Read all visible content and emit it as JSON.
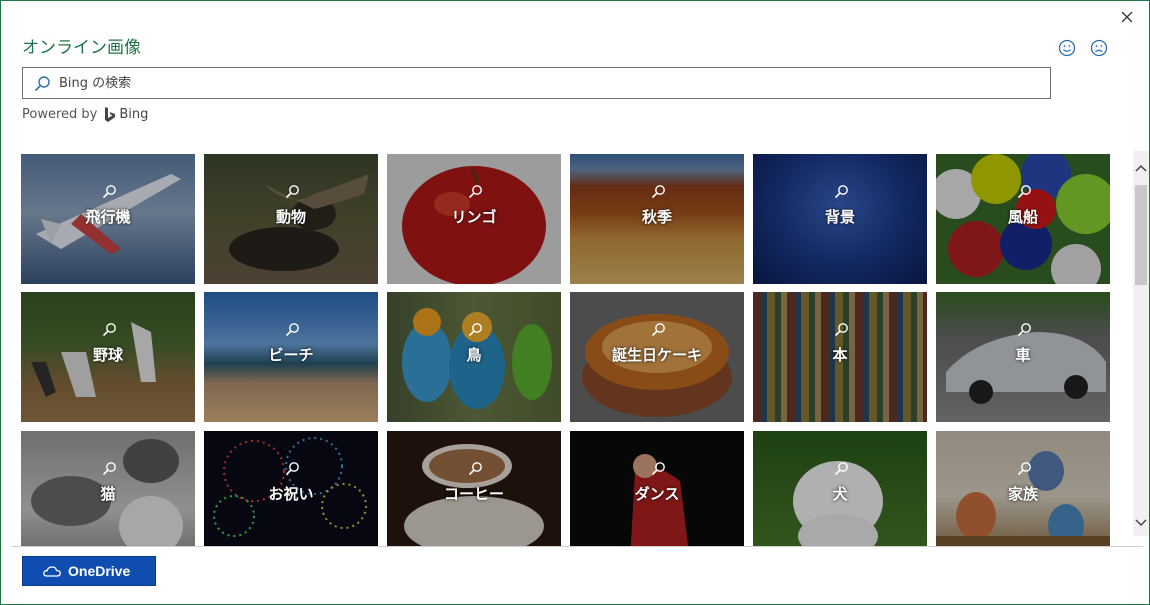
{
  "dialog": {
    "title": "オンライン画像",
    "close_icon": "close-icon",
    "feedback": {
      "smile_icon": "smile-icon",
      "frown_icon": "frown-icon"
    }
  },
  "search": {
    "placeholder": "Bing の検索",
    "value": "",
    "icon": "search-icon"
  },
  "powered": {
    "prefix": "Powered by",
    "brand": "Bing"
  },
  "categories": [
    {
      "label": "飛行機"
    },
    {
      "label": "動物"
    },
    {
      "label": "リンゴ"
    },
    {
      "label": "秋季"
    },
    {
      "label": "背景"
    },
    {
      "label": "風船"
    },
    {
      "label": "野球"
    },
    {
      "label": "ビーチ"
    },
    {
      "label": "鳥"
    },
    {
      "label": "誕生日ケーキ"
    },
    {
      "label": "本"
    },
    {
      "label": "車"
    },
    {
      "label": "猫"
    },
    {
      "label": "お祝い"
    },
    {
      "label": "コーヒー"
    },
    {
      "label": "ダンス"
    },
    {
      "label": "犬"
    },
    {
      "label": "家族"
    }
  ],
  "footer": {
    "onedrive_label": "OneDrive"
  },
  "colors": {
    "accent": "#217346",
    "onedrive_button": "#0f4eb0"
  }
}
